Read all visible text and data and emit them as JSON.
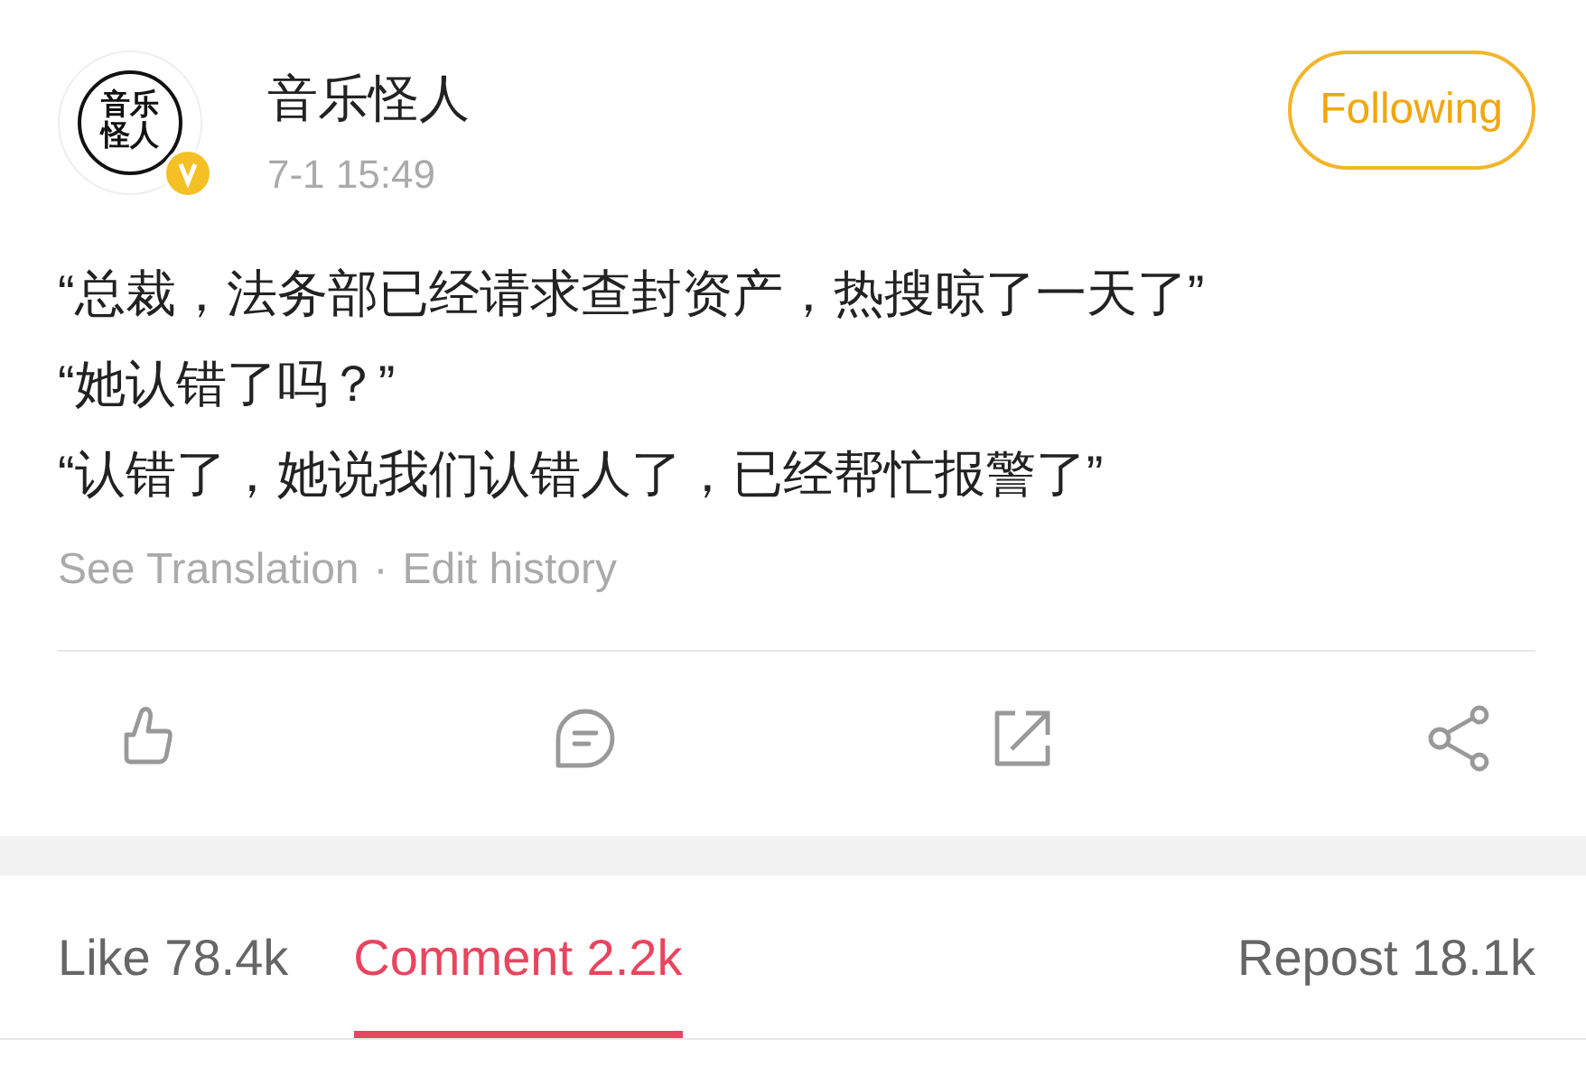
{
  "post": {
    "avatar_text": "音乐怪人",
    "verified": true,
    "author": "音乐怪人",
    "time": "7-1 15:49",
    "follow_button": "Following",
    "lines": [
      "“总裁，法务部已经请求查封资产，热搜晾了一天了”",
      "“她认错了吗？”",
      "“认错了，她说我们认错人了，已经帮忙报警了”"
    ],
    "links": [
      "See Translation",
      "Edit history"
    ],
    "link_separator": "·"
  },
  "actions": [
    {
      "kind": "like"
    },
    {
      "kind": "comment"
    },
    {
      "kind": "repost"
    },
    {
      "kind": "share"
    }
  ],
  "tabs": [
    {
      "label": "Like 78.4k",
      "selected": false
    },
    {
      "label": "Comment 2.2k",
      "selected": true
    },
    {
      "label": "Repost 18.1k",
      "selected": false
    }
  ]
}
